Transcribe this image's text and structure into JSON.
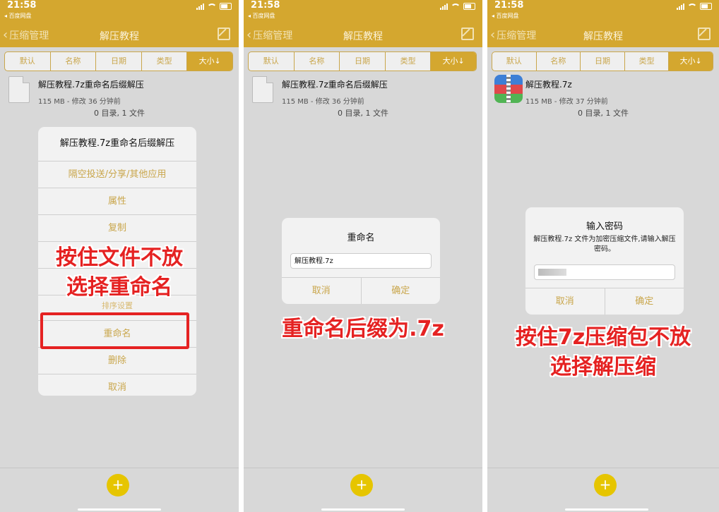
{
  "common": {
    "time": "21:58",
    "back_app": "◂ 百度网盘",
    "nav_back": "压缩管理",
    "nav_title": "解压教程",
    "sort_tabs": [
      "默认",
      "名称",
      "日期",
      "类型",
      "大小↓"
    ],
    "fab": "+"
  },
  "panel1": {
    "file_name": "解压教程.7z重命名后缀解压",
    "file_meta": "115 MB - 修改 36 分钟前",
    "dir_info": "0 目录, 1 文件",
    "sheet_title": "解压教程.7z重命名后缀解压",
    "sheet_items": [
      "隔空投送/分享/其他应用",
      "属性",
      "复制",
      "",
      "",
      "",
      "重命名",
      "删除",
      "取消"
    ],
    "hidden_item": "排序设置",
    "annotation_line1": "按住文件不放",
    "annotation_line2": "选择重命名"
  },
  "panel2": {
    "file_name": "解压教程.7z重命名后缀解压",
    "file_meta": "115 MB - 修改 36 分钟前",
    "dir_info": "0 目录, 1 文件",
    "dialog_title": "重命名",
    "dialog_value": "解压教程.7z",
    "cancel": "取消",
    "confirm": "确定",
    "annotation": "重命名后缀为.7z"
  },
  "panel3": {
    "file_name": "解压教程.7z",
    "file_meta": "115 MB - 修改 37 分钟前",
    "dir_info": "0 目录, 1 文件",
    "dialog_title": "输入密码",
    "dialog_msg": "解压教程.7z 文件为加密压缩文件,请输入解压密码。",
    "cancel": "取消",
    "confirm": "确定",
    "annotation_line1": "按住7z压缩包不放",
    "annotation_line2": "选择解压缩"
  }
}
